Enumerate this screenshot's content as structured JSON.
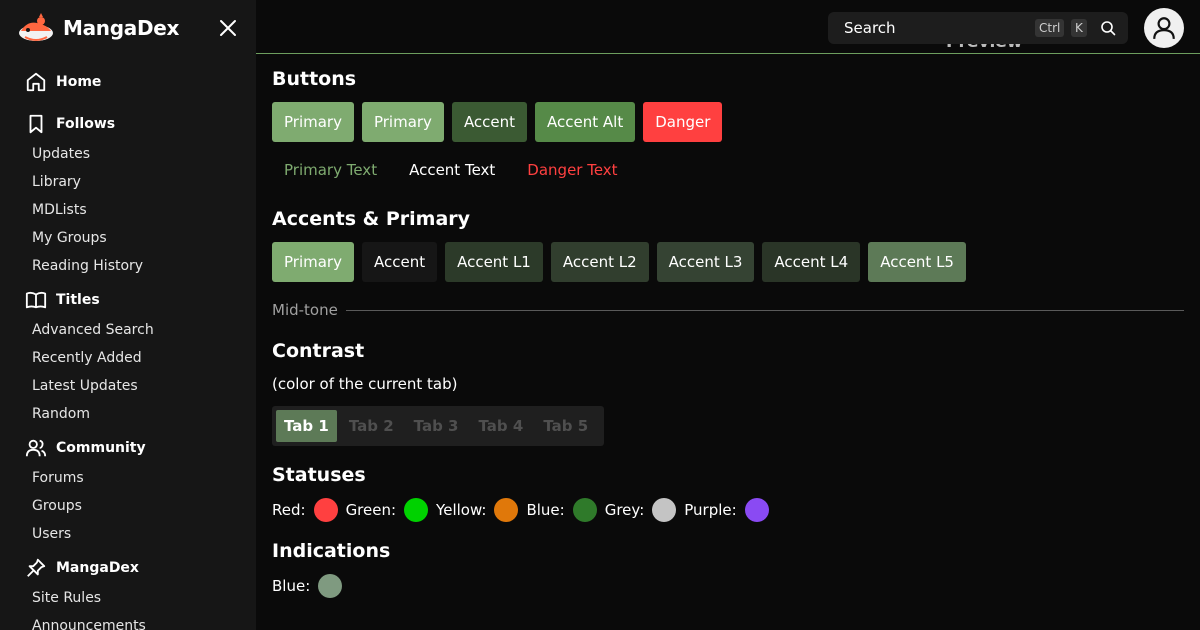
{
  "brand": {
    "name": "MangaDex"
  },
  "sidebar": {
    "sections": [
      {
        "title": "Home",
        "icon": "home-icon",
        "items": []
      },
      {
        "title": "Follows",
        "icon": "bookmark-icon",
        "items": [
          "Updates",
          "Library",
          "MDLists",
          "My Groups",
          "Reading History"
        ]
      },
      {
        "title": "Titles",
        "icon": "book-icon",
        "items": [
          "Advanced Search",
          "Recently Added",
          "Latest Updates",
          "Random"
        ]
      },
      {
        "title": "Community",
        "icon": "users-icon",
        "items": [
          "Forums",
          "Groups",
          "Users"
        ]
      },
      {
        "title": "MangaDex",
        "icon": "pin-icon",
        "items": [
          "Site Rules",
          "Announcements"
        ]
      }
    ]
  },
  "topbar": {
    "search_placeholder": "Search",
    "kbd_ctrl": "Ctrl",
    "kbd_k": "K",
    "preview": "Preview"
  },
  "buttons": {
    "title": "Buttons",
    "items": [
      {
        "label": "Primary",
        "bg": "#7fab70",
        "fg": "#ffffff"
      },
      {
        "label": "Primary",
        "bg": "#7fab70",
        "fg": "#ffffff"
      },
      {
        "label": "Accent",
        "bg": "#3b5a33",
        "fg": "#ffffff"
      },
      {
        "label": "Accent Alt",
        "bg": "#568a48",
        "fg": "#ffffff"
      },
      {
        "label": "Danger",
        "bg": "#ff4040",
        "fg": "#ffffff"
      }
    ],
    "text_items": [
      {
        "label": "Primary Text",
        "color": "#7fab70"
      },
      {
        "label": "Accent Text",
        "color": "#ffffff"
      },
      {
        "label": "Danger Text",
        "color": "#ff4040"
      }
    ]
  },
  "accents": {
    "title": "Accents & Primary",
    "items": [
      {
        "label": "Primary",
        "bg": "#7fab70"
      },
      {
        "label": "Accent",
        "bg": "#161616"
      },
      {
        "label": "Accent L1",
        "bg": "#2c3a29"
      },
      {
        "label": "Accent L2",
        "bg": "#313e2e"
      },
      {
        "label": "Accent L3",
        "bg": "#354333"
      },
      {
        "label": "Accent L4",
        "bg": "#2a3527"
      },
      {
        "label": "Accent L5",
        "bg": "#5d7a57"
      }
    ]
  },
  "midtone": {
    "label": "Mid-tone"
  },
  "contrast": {
    "title": "Contrast",
    "subtitle": "(color of the current tab)",
    "tabs": [
      "Tab 1",
      "Tab 2",
      "Tab 3",
      "Tab 4",
      "Tab 5"
    ],
    "active_index": 0
  },
  "statuses": {
    "title": "Statuses",
    "items": [
      {
        "label": "Red:",
        "color": "#ff4040"
      },
      {
        "label": "Green:",
        "color": "#00d200"
      },
      {
        "label": "Yellow:",
        "color": "#e0780a"
      },
      {
        "label": "Blue:",
        "color": "#2f7a2a"
      },
      {
        "label": "Grey:",
        "color": "#c4c4c4"
      },
      {
        "label": "Purple:",
        "color": "#8a4af3"
      }
    ]
  },
  "indications": {
    "title": "Indications",
    "items": [
      {
        "label": "Blue:",
        "color": "#7f9a80"
      }
    ]
  }
}
